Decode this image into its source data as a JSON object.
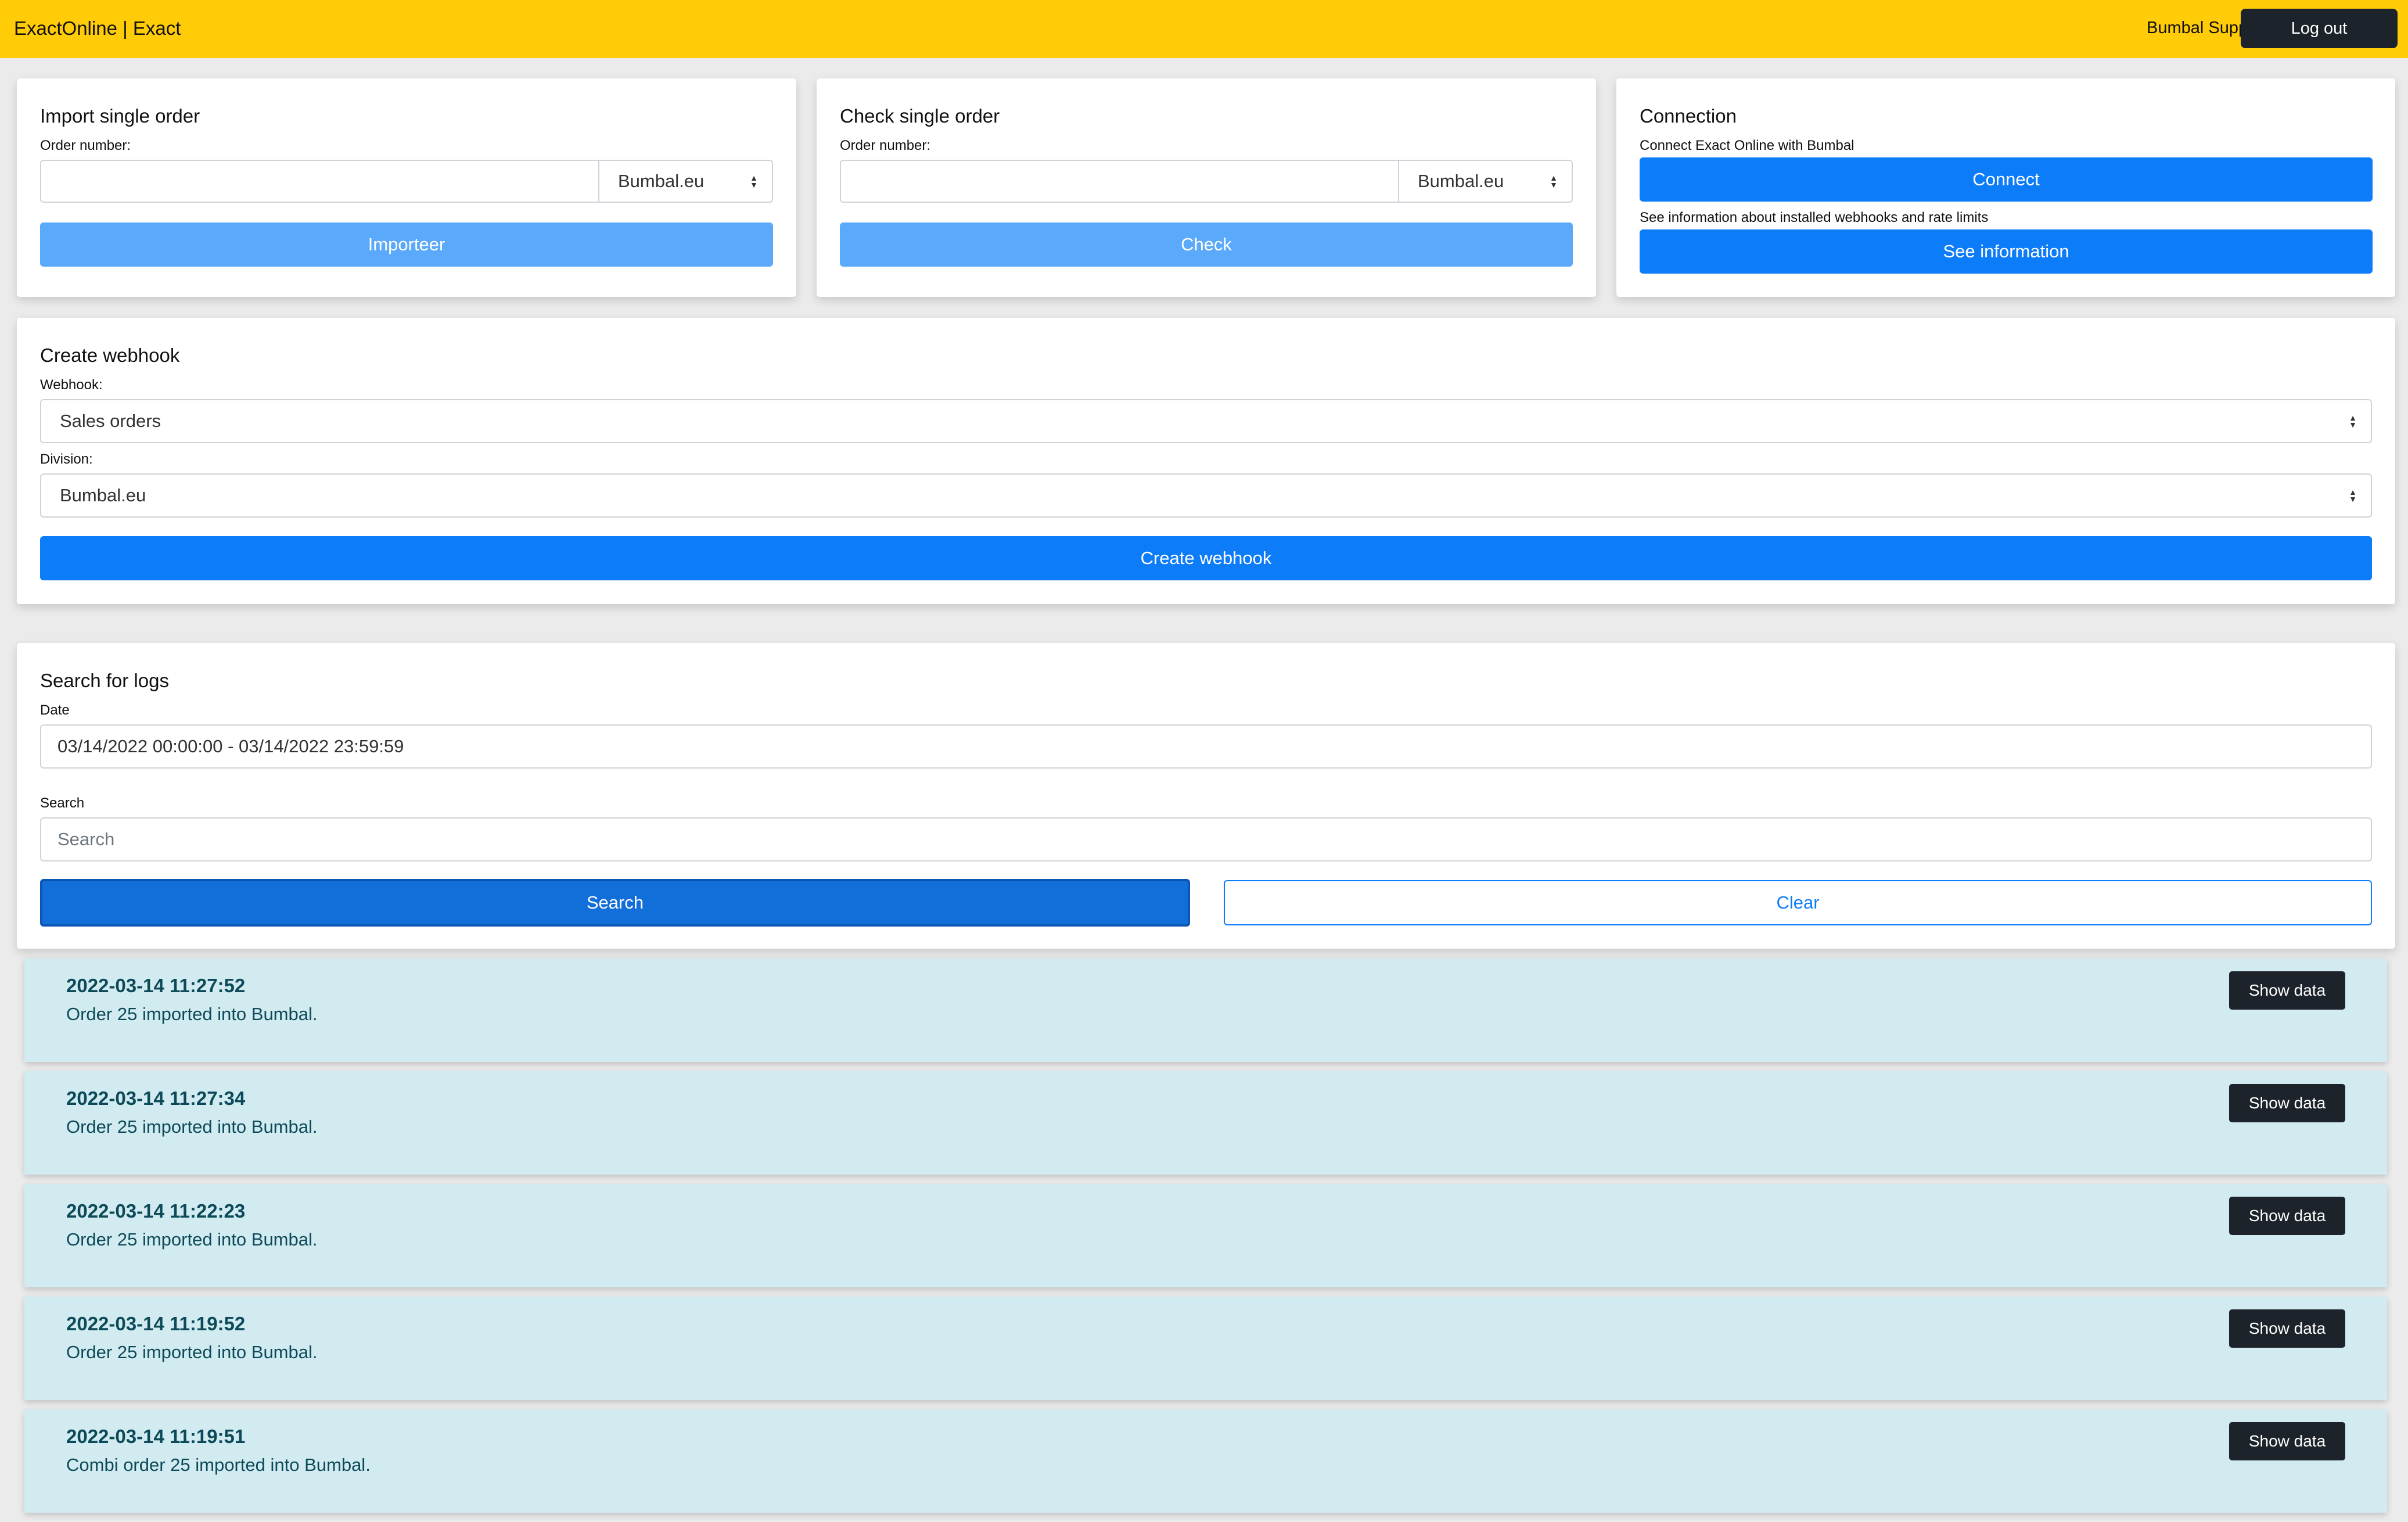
{
  "navbar": {
    "brand": "ExactOnline | Exact",
    "user": "Bumbal Support",
    "logout_label": "Log out",
    "background": "#ffcc07"
  },
  "import_card": {
    "title": "Import single order",
    "order_label": "Order number:",
    "order_value": "",
    "division_selected": "Bumbal.eu",
    "button_label": "Importeer"
  },
  "check_card": {
    "title": "Check single order",
    "order_label": "Order number:",
    "order_value": "",
    "division_selected": "Bumbal.eu",
    "button_label": "Check"
  },
  "connection_card": {
    "title": "Connection",
    "connect_desc": "Connect Exact Online with Bumbal",
    "connect_label": "Connect",
    "info_desc": "See information about installed webhooks and rate limits",
    "info_label": "See information"
  },
  "webhook_card": {
    "title": "Create webhook",
    "webhook_label": "Webhook:",
    "webhook_selected": "Sales orders",
    "division_label": "Division:",
    "division_selected": "Bumbal.eu",
    "button_label": "Create webhook"
  },
  "search_card": {
    "title": "Search for logs",
    "date_label": "Date",
    "date_value": "03/14/2022 00:00:00 - 03/14/2022 23:59:59",
    "search_label": "Search",
    "search_placeholder": "Search",
    "search_button": "Search",
    "clear_button": "Clear"
  },
  "logs": [
    {
      "time": "2022-03-14 11:27:52",
      "message": "Order 25 imported into Bumbal.",
      "button": "Show data"
    },
    {
      "time": "2022-03-14 11:27:34",
      "message": "Order 25 imported into Bumbal.",
      "button": "Show data"
    },
    {
      "time": "2022-03-14 11:22:23",
      "message": "Order 25 imported into Bumbal.",
      "button": "Show data"
    },
    {
      "time": "2022-03-14 11:19:52",
      "message": "Order 25 imported into Bumbal.",
      "button": "Show data"
    },
    {
      "time": "2022-03-14 11:19:51",
      "message": "Combi order 25 imported into Bumbal.",
      "button": "Show data"
    }
  ]
}
